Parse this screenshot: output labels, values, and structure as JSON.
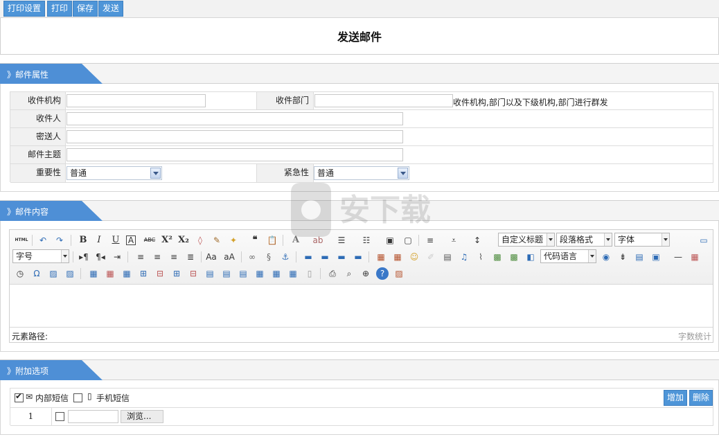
{
  "toolbar": {
    "print_settings": "打印设置",
    "print": "打印",
    "save": "保存",
    "send": "发送"
  },
  "page_title": "发送邮件",
  "sections": {
    "mail_props": "邮件属性",
    "mail_content": "邮件内容",
    "extra_options": "附加选项"
  },
  "form": {
    "recipient_org_label": "收件机构",
    "recipient_dept_label": "收件部门",
    "group_send_hint": "收件机构,部门以及下级机构,部门进行群发",
    "recipient_label": "收件人",
    "bcc_label": "密送人",
    "subject_label": "邮件主题",
    "importance_label": "重要性",
    "importance_value": "普通",
    "urgency_label": "紧急性",
    "urgency_value": "普通"
  },
  "editor": {
    "custom_heading": "自定义标题",
    "paragraph_format": "段落格式",
    "font_family": "字体",
    "font_size": "字号",
    "code_language": "代码语言",
    "element_path": "元素路径:",
    "word_count": "字数统计",
    "html_label": "HTML"
  },
  "options": {
    "internal_sms": "内部短信",
    "internal_sms_checked": true,
    "mobile_sms": "手机短信",
    "mobile_sms_checked": false,
    "add_button": "增加",
    "delete_button": "删除",
    "row_index": "1",
    "browse_button": "浏览..."
  },
  "colors": {
    "accent": "#4e95d8",
    "section_tab": "#4e8fd6"
  },
  "watermark_text": "安下载"
}
